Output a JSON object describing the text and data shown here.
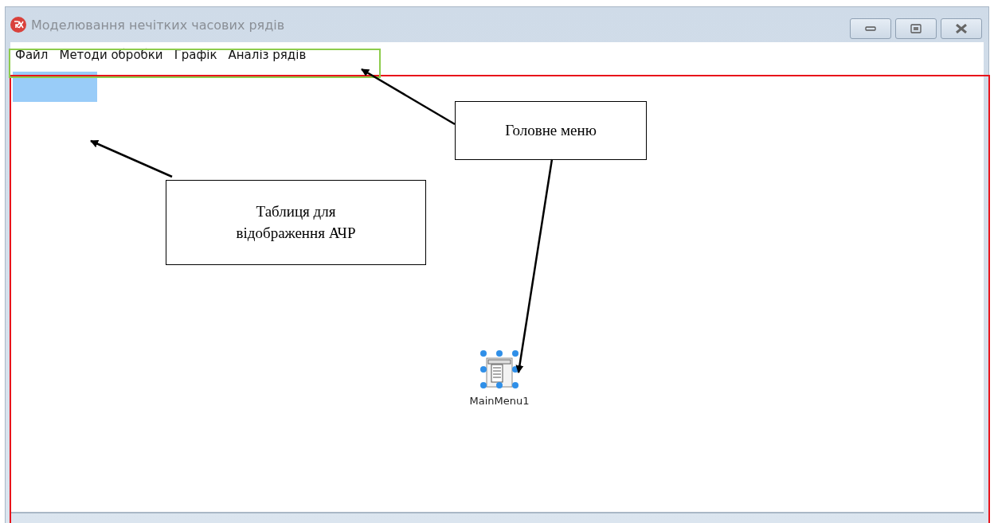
{
  "window": {
    "title": "Моделювання нечітких часових рядів"
  },
  "menu": [
    {
      "label": "Файл"
    },
    {
      "label": "Методи обробки"
    },
    {
      "label": "Графік"
    },
    {
      "label": "Аналіз рядів"
    }
  ],
  "form": {
    "component": {
      "label": "MainMenu1"
    }
  },
  "annotations": [
    {
      "text": "Головне меню"
    },
    {
      "text": "Таблиця для відображення АЧР"
    }
  ]
}
